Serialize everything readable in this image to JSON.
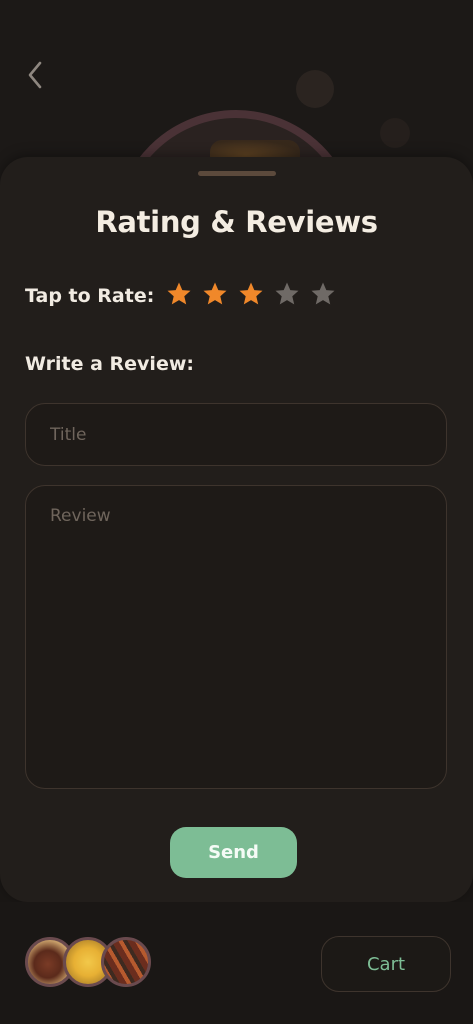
{
  "header": {
    "back_icon": "chevron-left-icon"
  },
  "sheet": {
    "title": "Rating & Reviews",
    "rate_label": "Tap to Rate:",
    "rating": {
      "value": 3,
      "max": 5
    },
    "colors": {
      "star_filled": "#f0882a",
      "star_empty": "#6f6a66",
      "accent": "#7dbd95"
    },
    "review_label": "Write a Review:",
    "title_field": {
      "placeholder": "Title",
      "value": ""
    },
    "review_field": {
      "placeholder": "Review",
      "value": ""
    },
    "send_label": "Send"
  },
  "bottom_bar": {
    "cart_items": [
      "steak-dish",
      "pasta-dish",
      "skewer-dish"
    ],
    "cart_label": "Cart"
  }
}
